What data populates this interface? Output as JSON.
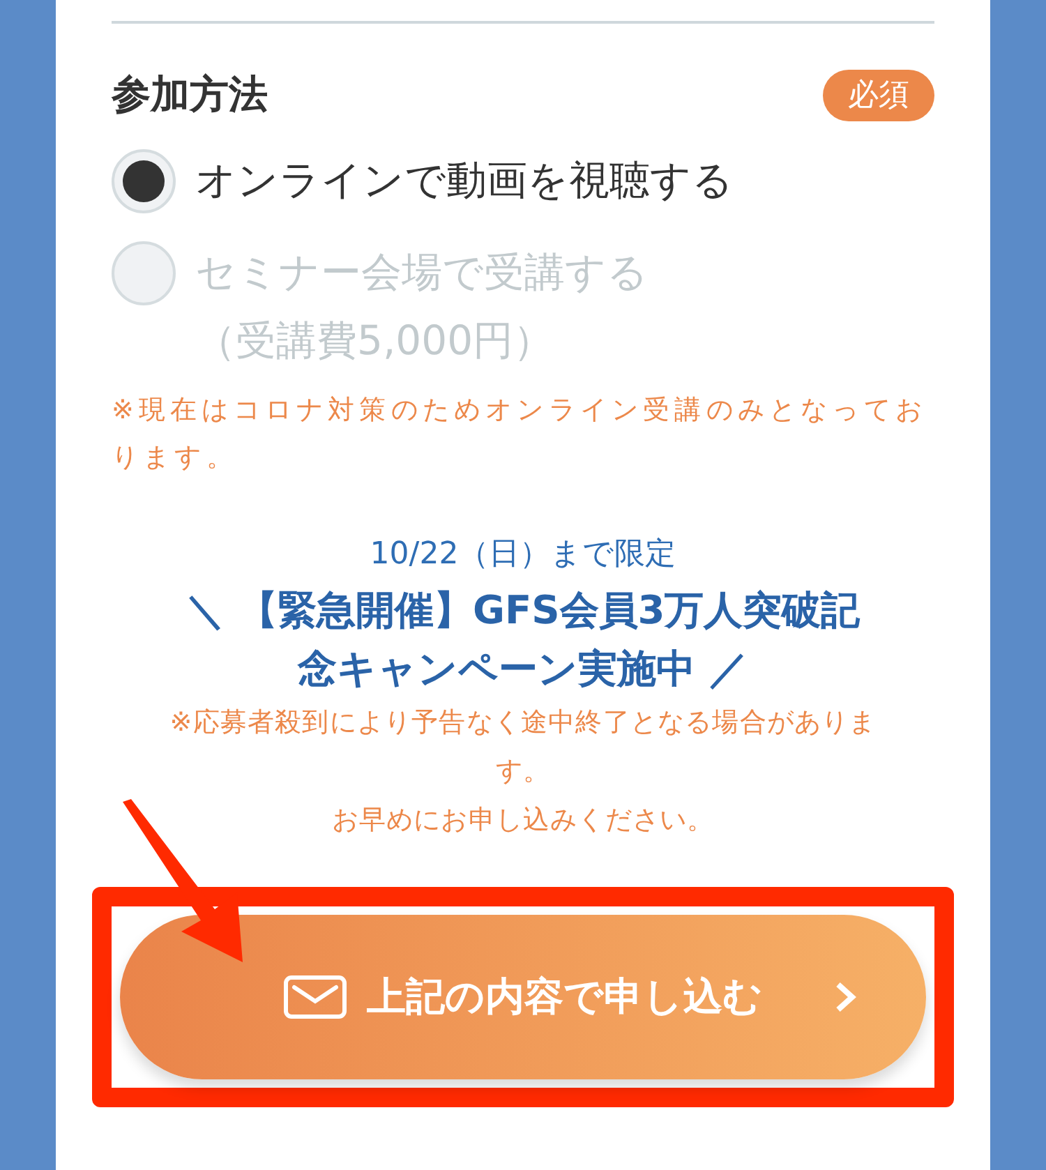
{
  "section": {
    "title": "参加方法",
    "badge": "必須"
  },
  "options": [
    {
      "label": "オンラインで動画を視聴する",
      "selected": true,
      "disabled": false
    },
    {
      "label": "セミナー会場で受講する",
      "sublabel": "（受講費5,000円）",
      "selected": false,
      "disabled": true
    }
  ],
  "note": "※現在はコロナ対策のためオンライン受講のみとなっております。",
  "campaign": {
    "deadline": "10/22（日）まで限定",
    "headline": "＼ 【緊急開催】GFS会員3万人突破記念キャンペーン実施中 ／",
    "notes": [
      "※応募者殺到により予告なく途中終了となる場合があります。",
      "お早めにお申し込みください。"
    ]
  },
  "submit": {
    "label": "上記の内容で申し込む"
  }
}
